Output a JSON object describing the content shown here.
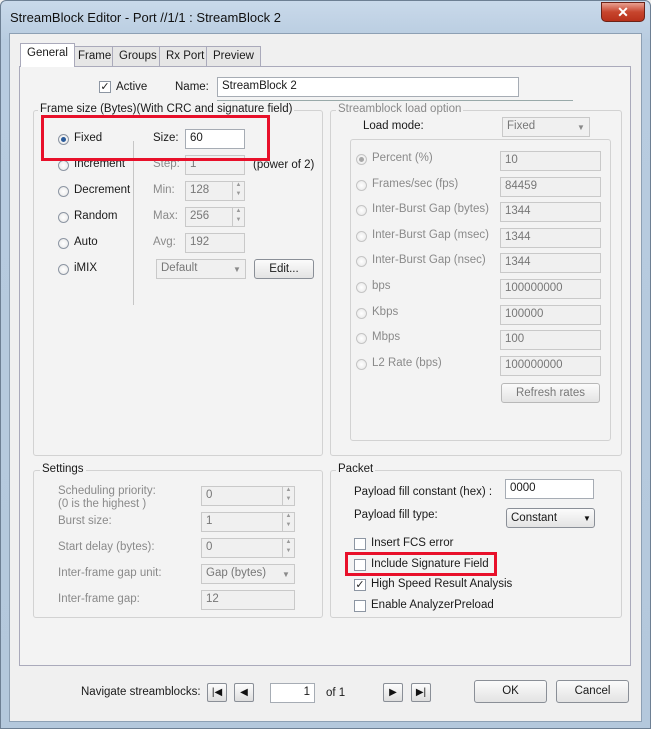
{
  "window": {
    "title": "StreamBlock Editor - Port //1/1 : StreamBlock 2",
    "close_glyph": "✕"
  },
  "tabs": [
    "General",
    "Frame",
    "Groups",
    "Rx Port",
    "Preview"
  ],
  "general": {
    "active_label": "Active",
    "active_checked": true,
    "name_label": "Name:",
    "name_value": "StreamBlock 2"
  },
  "frame_size": {
    "title": "Frame size (Bytes)(With CRC and signature field)",
    "modes": [
      "Fixed",
      "Increment",
      "Decrement",
      "Random",
      "Auto",
      "iMIX"
    ],
    "selected": "Fixed",
    "size_label": "Size:",
    "size_value": "60",
    "step_label": "Step:",
    "step_value": "1",
    "step_suffix": "(power of 2)",
    "min_label": "Min:",
    "min_value": "128",
    "max_label": "Max:",
    "max_value": "256",
    "avg_label": "Avg:",
    "avg_value": "192",
    "imix_value": "Default",
    "edit_label": "Edit..."
  },
  "load_option": {
    "title": "Streamblock load option",
    "mode_label": "Load mode:",
    "mode_value": "Fixed",
    "rows": [
      {
        "label": "Percent (%)",
        "value": "10",
        "selected": true
      },
      {
        "label": "Frames/sec (fps)",
        "value": "84459"
      },
      {
        "label": "Inter-Burst Gap (bytes)",
        "value": "1344"
      },
      {
        "label": "Inter-Burst Gap (msec)",
        "value": "1344"
      },
      {
        "label": "Inter-Burst Gap (nsec)",
        "value": "1344"
      },
      {
        "label": "bps",
        "value": "100000000"
      },
      {
        "label": "Kbps",
        "value": "100000"
      },
      {
        "label": "Mbps",
        "value": "100"
      },
      {
        "label": "L2 Rate (bps)",
        "value": "100000000"
      }
    ],
    "refresh_label": "Refresh rates"
  },
  "settings": {
    "title": "Settings",
    "priority_label_1": "Scheduling priority:",
    "priority_label_2": "(0 is the highest )",
    "priority_value": "0",
    "burst_label": "Burst size:",
    "burst_value": "1",
    "delay_label": "Start delay (bytes):",
    "delay_value": "0",
    "gap_unit_label": "Inter-frame gap unit:",
    "gap_unit_value": "Gap (bytes)",
    "gap_label": "Inter-frame gap:",
    "gap_value": "12"
  },
  "packet": {
    "title": "Packet",
    "fill_const_label": "Payload fill constant (hex) :",
    "fill_const_value": "0000",
    "fill_type_label": "Payload fill type:",
    "fill_type_value": "Constant",
    "checks": [
      {
        "label": "Insert FCS error",
        "checked": false
      },
      {
        "label": "Include Signature Field",
        "checked": false
      },
      {
        "label": "High Speed Result Analysis",
        "checked": true
      },
      {
        "label": "Enable AnalyzerPreload",
        "checked": false
      }
    ]
  },
  "footer": {
    "navigate_label": "Navigate streamblocks:",
    "page_value": "1",
    "of_label": "of 1",
    "ok_label": "OK",
    "cancel_label": "Cancel"
  },
  "colors": {
    "highlight": "#e8102a",
    "accent": "#2a5b9a"
  }
}
